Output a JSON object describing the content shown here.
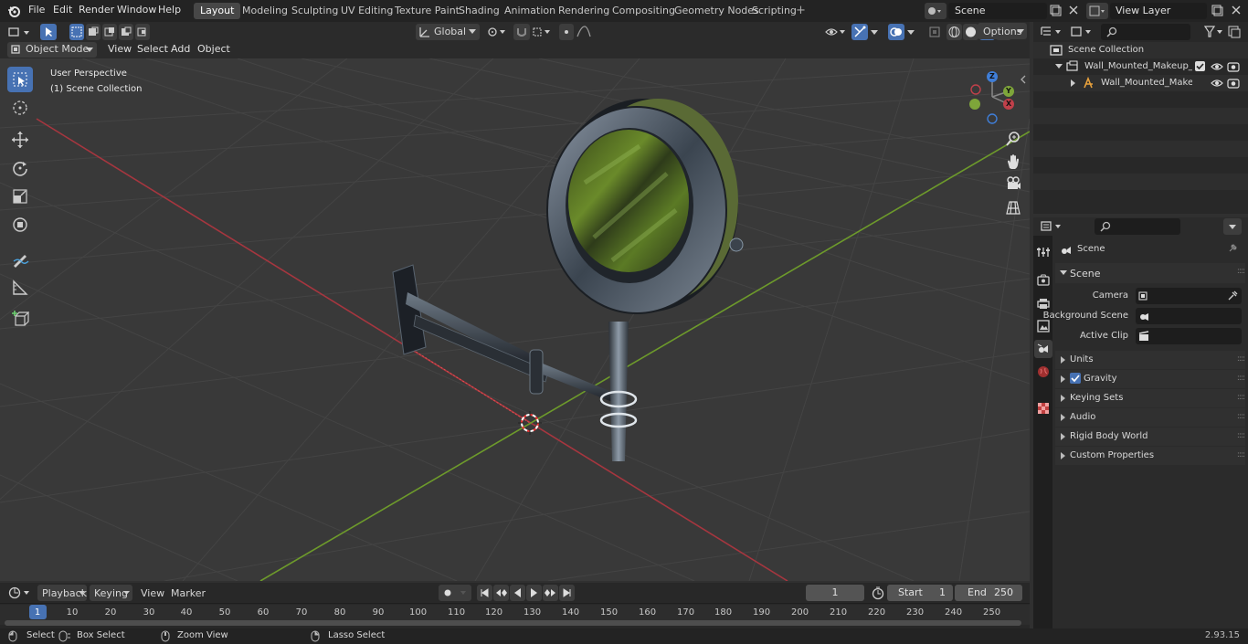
{
  "menu": {
    "file": "File",
    "edit": "Edit",
    "render": "Render",
    "window": "Window",
    "help": "Help"
  },
  "workspaces": [
    "Layout",
    "Modeling",
    "Sculpting",
    "UV Editing",
    "Texture Paint",
    "Shading",
    "Animation",
    "Rendering",
    "Compositing",
    "Geometry Nodes",
    "Scripting"
  ],
  "workspace_add": "+",
  "scene_field": "Scene",
  "view_layer_field": "View Layer",
  "header": {
    "orientation": "Global",
    "options": "Options",
    "mode": "Object Mode",
    "view": "View",
    "select": "Select",
    "add": "Add",
    "object": "Object"
  },
  "viewport": {
    "perspective": "User Perspective",
    "collection": "(1) Scene Collection",
    "gizmo": {
      "x": "X",
      "y": "Y",
      "z": "Z"
    }
  },
  "outliner": {
    "root": "Scene Collection",
    "item1": "Wall_Mounted_Makeup_Mirro",
    "item2": "Wall_Mounted_Makeup_I"
  },
  "properties": {
    "context": "Scene",
    "panel": "Scene",
    "camera_label": "Camera",
    "bg_scene_label": "Background Scene",
    "active_clip_label": "Active Clip",
    "sections": [
      "Units",
      "Gravity",
      "Keying Sets",
      "Audio",
      "Rigid Body World",
      "Custom Properties"
    ],
    "gravity_checked": true
  },
  "timeline": {
    "playback": "Playback",
    "keying": "Keying",
    "view": "View",
    "marker": "Marker",
    "current_frame": "1",
    "start_label": "Start",
    "start_value": "1",
    "end_label": "End",
    "end_value": "250",
    "ticks": [
      "1",
      "10",
      "20",
      "30",
      "40",
      "50",
      "60",
      "70",
      "80",
      "90",
      "100",
      "110",
      "120",
      "130",
      "140",
      "150",
      "160",
      "170",
      "180",
      "190",
      "200",
      "210",
      "220",
      "230",
      "240",
      "250"
    ]
  },
  "status": {
    "select": "Select",
    "box_select": "Box Select",
    "zoom_view": "Zoom View",
    "lasso_select": "Lasso Select",
    "version": "2.93.15"
  },
  "colors": {
    "accent": "#4772b3",
    "x_axis": "#c0404a",
    "y_axis": "#7ea53a",
    "z_axis": "#3f7ed8",
    "background": "#393939"
  }
}
